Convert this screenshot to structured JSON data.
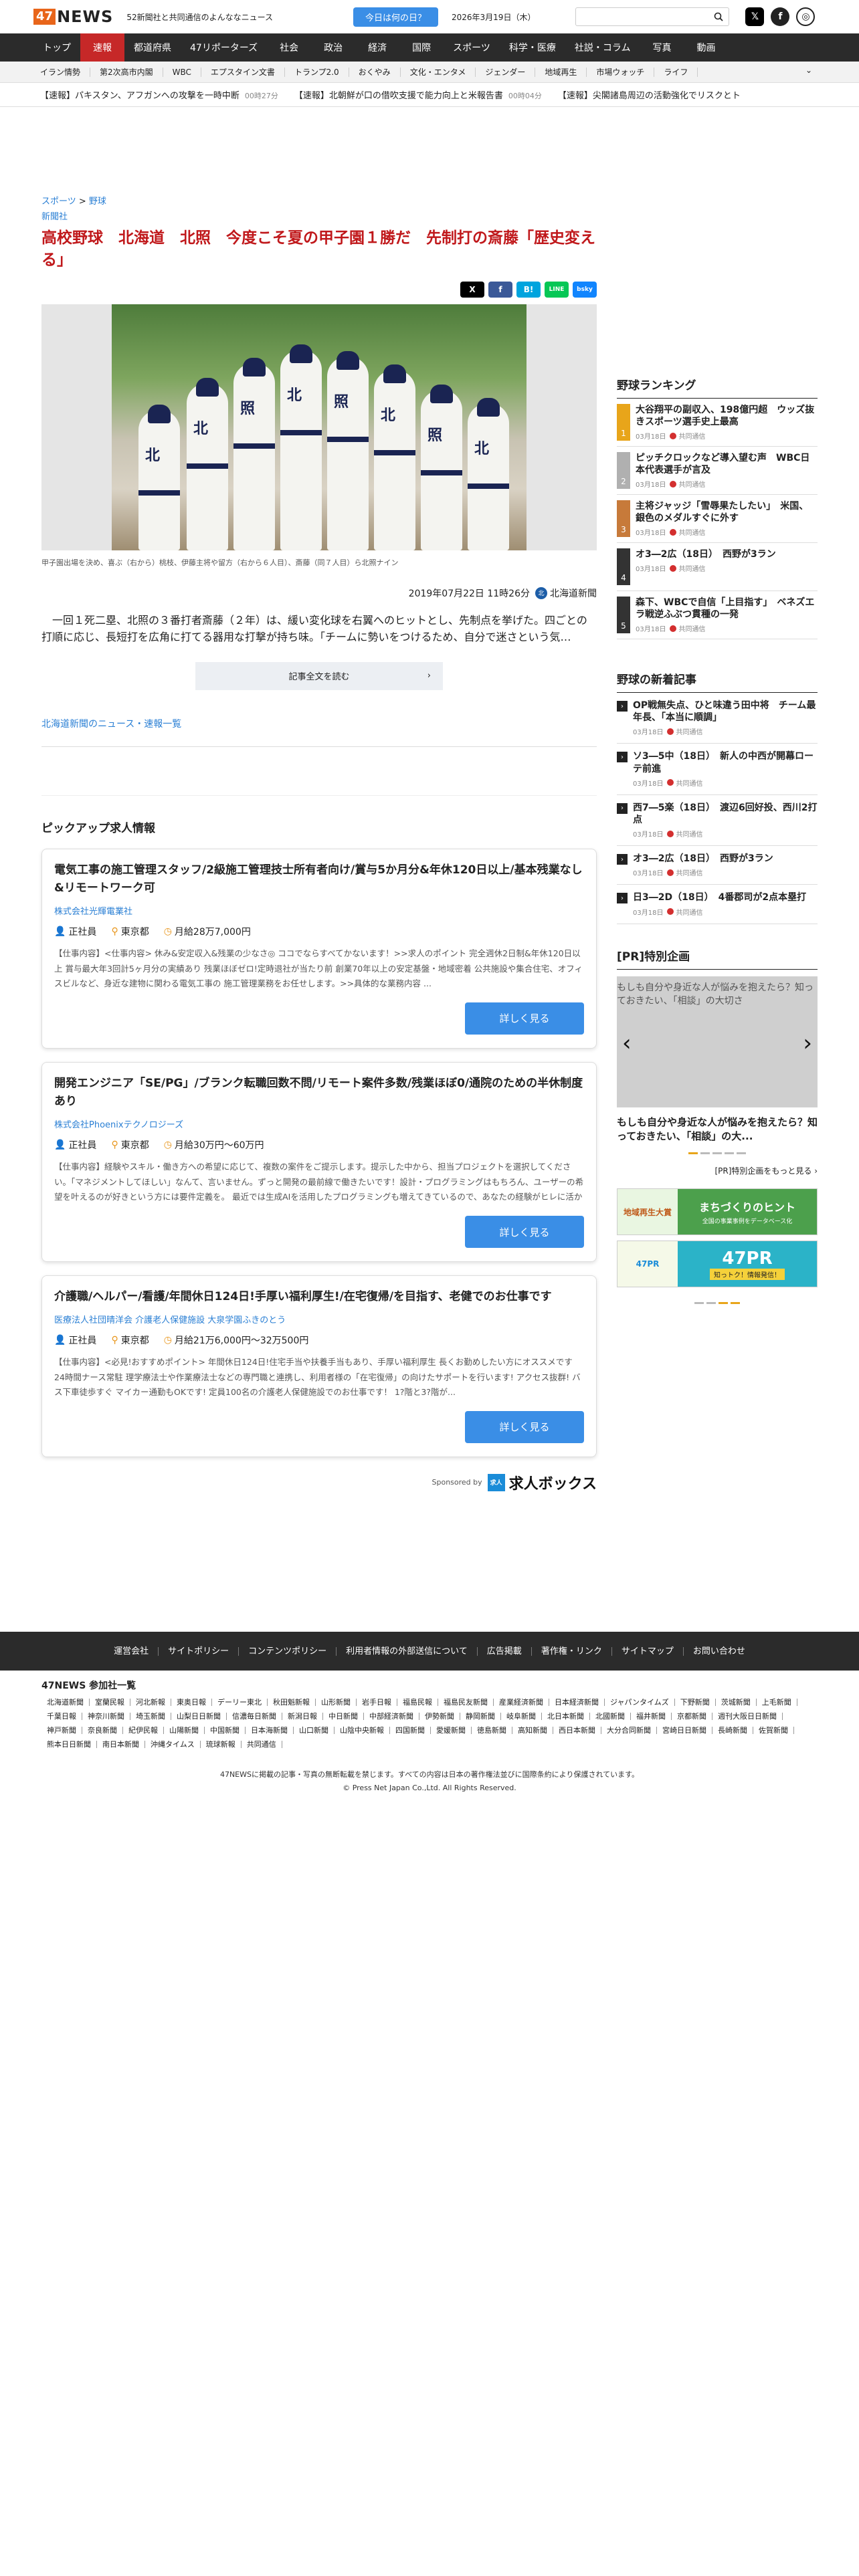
{
  "header": {
    "logo_box": "47",
    "logo_text": "NEWS",
    "tagline": "52新聞社と共同通信のよんななニュース",
    "today_button": "今日は何の日？",
    "date": "2026年3月19日（木）"
  },
  "nav": [
    "トップ",
    "速報",
    "都道府県",
    "47リポーターズ",
    "社会",
    "政治",
    "経済",
    "国際",
    "スポーツ",
    "科学・医療",
    "社説・コラム",
    "写真",
    "動画"
  ],
  "subnav": [
    "イラン情勢",
    "第2次高市内閣",
    "WBC",
    "エプスタイン文書",
    "トランプ2.0",
    "おくやみ",
    "文化・エンタメ",
    "ジェンダー",
    "地域再生",
    "市場ウォッチ",
    "ライフ"
  ],
  "ticker": [
    {
      "text": "【速報】パキスタン、アフガンへの攻撃を一時中断",
      "ago": "00時27分"
    },
    {
      "text": "【速報】北朝鮮が口の借吹支援で能力向上と米報告書",
      "ago": "00時04分"
    },
    {
      "text": "【速報】尖閣諸島周辺の活動強化でリスクとト",
      "ago": ""
    }
  ],
  "article": {
    "crumb_1": "スポーツ",
    "crumb_sep": " > ",
    "crumb_2": "野球",
    "source_link": "新聞社",
    "title": "高校野球　北海道　北照　今度こそ夏の甲子園１勝だ　先制打の斎藤「歴史変える」",
    "share": [
      "X",
      "f",
      "B!",
      "LINE",
      "bsky"
    ],
    "caption": "甲子園出場を決め、喜ぶ（右から）桃枝、伊藤主将や留方（右から６人目）、斎藤（同７人目）ら北照ナイン",
    "datetime": "2019年07月22日 11時26分",
    "publisher": "北海道新聞",
    "publisher_icon": "北",
    "lead": "一回１死二塁、北照の３番打者斎藤（２年）は、緩い変化球を右翼へのヒットとし、先制点を挙げた。四ごとの打順に応じ、長短打を広角に打てる器用な打撃が持ち味。「チームに勢いをつけるため、自分で迷さという気…",
    "read_more": "記事全文を読む",
    "read_more_chev": "›",
    "hk_news_link": "北海道新聞のニュース・速報一覧"
  },
  "photo": {
    "player_marks": [
      "北",
      "北",
      "照",
      "北",
      "照",
      "北",
      "照",
      "北"
    ]
  },
  "pickup": {
    "title": "ピックアップ求人情報",
    "detail_button": "詳しく見る",
    "jobs": [
      {
        "title": "電気工事の施工管理スタッフ/2級施工管理技士所有者向け/賞与5か月分&年休120日以上/基本残業なし&リモートワーク可",
        "company": "株式会社光輝電業社",
        "type": "正社員",
        "location": "東京都",
        "salary": "月給28万7,000円",
        "desc": "【仕事内容】<仕事内容> 休み&安定収入&残業の少なさ◎ ココでならすべてかないます！>>求人のポイント 完全週休2日制&年休120日以上 賞与最大年3回計5ヶ月分の実績あり 残業ほぼゼロ!定時退社が当たり前 創業70年以上の安定基盤・地域密着 公共施設や集合住宅、オフィスビルなど、身近な建物に関わる電気工事の 施工管理業務をお任せします。>>具体的な業務内容 ..."
      },
      {
        "title": "開発エンジニア「SE/PG」/ブランク転職回数不問/リモート案件多数/残業ほぼ0/通院のための半休制度あり",
        "company": "株式会社Phoenixテクノロジーズ",
        "type": "正社員",
        "location": "東京都",
        "salary": "月給30万円〜60万円",
        "desc": "【仕事内容】経験やスキル・働き方への希望に応じて、複数の案件をご提示します。提示した中から、担当プロジェクトを選択してください。「マネジメントしてほしい」なんて、言いません。ずっと開発の最前線で働きたいです！設計・プログラミングはもちろん、ユーザーの希望を叶えるのが好きという方には要件定義を。 最近では生成AIを活用したプログラミングも増えてきているので、あなたの経験がヒレに活かせ..."
      },
      {
        "title": "介護職/ヘルパー/看護/年間休日124日!手厚い福利厚生!/在宅復帰/を目指す、老健でのお仕事です",
        "company": "医療法人社団晴洋会 介護老人保健施設 大泉学園ふきのとう",
        "type": "正社員",
        "location": "東京都",
        "salary": "月給21万6,000円〜32万500円",
        "desc": "【仕事内容】<必見!おすすめポイント> 年間休日124日!住宅手当や扶養手当もあり、手厚い福利厚生 長くお勤めしたい方にオススメです 24時間ナース常駐 理学療法士や作業療法士などの専門職と連携し、利用者様の「在宅復帰」の向けたサポートを行います! アクセス抜群! バス下車徒歩すぐ マイカー通勤もOKです! 定員100名の介護老人保健施設でのお仕事です！ 1?階と3?階が..."
      }
    ],
    "sponsored_by": "Sponsored by",
    "sponsor_name": "求人ボックス",
    "sponsor_mark": "求人"
  },
  "sidebar": {
    "ranking_title": "野球ランキング",
    "ranking": [
      {
        "rank": "1",
        "title": "大谷翔平の副収入、198億円超　ウッズ抜きスポーツ選手史上最高",
        "date": "03月18日",
        "src": "共同通信",
        "color": "#e8a51a"
      },
      {
        "rank": "2",
        "title": "ピッチクロックなど導入望む声　WBC日本代表選手が言及",
        "date": "03月18日",
        "src": "共同通信",
        "color": "#b0b0b0"
      },
      {
        "rank": "3",
        "title": "主将ジャッジ「雪辱果たしたい」　米国、銀色のメダルすぐに外す",
        "date": "03月18日",
        "src": "共同通信",
        "color": "#c77a3a"
      },
      {
        "rank": "4",
        "title": "オ3―2広（18日）　西野が3ラン",
        "date": "03月18日",
        "src": "共同通信",
        "color": "#333333"
      },
      {
        "rank": "5",
        "title": "森下、WBCで自信「上目指す」　ベネズエラ戦逆ふぶつ貫種の一発",
        "date": "03月18日",
        "src": "共同通信",
        "color": "#333333"
      }
    ],
    "new_title": "野球の新着記事",
    "new_arrow": "›",
    "new_items": [
      {
        "title": "OP戦無失点、ひと味違う田中将　チーム最年長、「本当に順調」",
        "date": "03月18日",
        "src": "共同通信"
      },
      {
        "title": "ソ3―5中（18日）　新人の中西が開幕ローテ前進",
        "date": "03月18日",
        "src": "共同通信"
      },
      {
        "title": "西7―5楽（18日）　渡辺6回好投、西川2打点",
        "date": "03月18日",
        "src": "共同通信"
      },
      {
        "title": "オ3―2広（18日）　西野が3ラン",
        "date": "03月18日",
        "src": "共同通信"
      },
      {
        "title": "日3―2D（18日）　4番郡司が2点本塁打",
        "date": "03月18日",
        "src": "共同通信"
      }
    ],
    "pr_title": "[PR]特別企画",
    "pr_caption": "もしも自分や身近な人が悩みを抱えたら？知っておきたい、「相談」の大切さ",
    "pr_text": "もしも自分や身近な人が悩みを抱えたら？知っておきたい、「相談」の大...",
    "pr_prev": "‹",
    "pr_next": "›",
    "pr_list": "[PR]特別企画をもっと見る ›",
    "banner1_left": "地域再生大賞",
    "banner1_right": "まちづくりのヒント",
    "banner1_sub": "全国の事業事例をデータベース化",
    "banner2_left": "47PR",
    "banner2_right": "47PR",
    "banner2_sub": "知っトク！情報発信！"
  },
  "footer": {
    "links": [
      "運営会社",
      "サイトポリシー",
      "コンテンツポリシー",
      "利用者情報の外部送信について",
      "広告掲載",
      "著作権・リンク",
      "サイトマップ",
      "お問い合わせ"
    ],
    "members_title": "47NEWS 参加社一覧",
    "members": [
      "北海道新聞",
      "室蘭民報",
      "河北新報",
      "東奥日報",
      "デーリー東北",
      "秋田魁新報",
      "山形新聞",
      "岩手日報",
      "福島民報",
      "福島民友新聞",
      "産業経済新聞",
      "日本経済新聞",
      "ジャパンタイムズ",
      "下野新聞",
      "茨城新聞",
      "上毛新聞",
      "千葉日報",
      "神奈川新聞",
      "埼玉新聞",
      "山梨日日新聞",
      "信濃毎日新聞",
      "新潟日報",
      "中日新聞",
      "中部経済新聞",
      "伊勢新聞",
      "静岡新聞",
      "岐阜新聞",
      "北日本新聞",
      "北國新聞",
      "福井新聞",
      "京都新聞",
      "週刊大阪日日新聞",
      "神戸新聞",
      "奈良新聞",
      "紀伊民報",
      "山陽新聞",
      "中国新聞",
      "日本海新聞",
      "山口新聞",
      "山陰中央新報",
      "四国新聞",
      "愛媛新聞",
      "徳島新聞",
      "高知新聞",
      "西日本新聞",
      "大分合同新聞",
      "宮崎日日新聞",
      "長崎新聞",
      "佐賀新聞",
      "熊本日日新聞",
      "南日本新聞",
      "沖縄タイムス",
      "琉球新報",
      "共同通信"
    ],
    "notice": "47NEWSに掲載の記事・写真の無断転載を禁じます。すべての内容は日本の著作権法並びに国際条約により保護されています。",
    "copyright": "© Press Net Japan Co.,Ltd. All Rights Reserved."
  }
}
